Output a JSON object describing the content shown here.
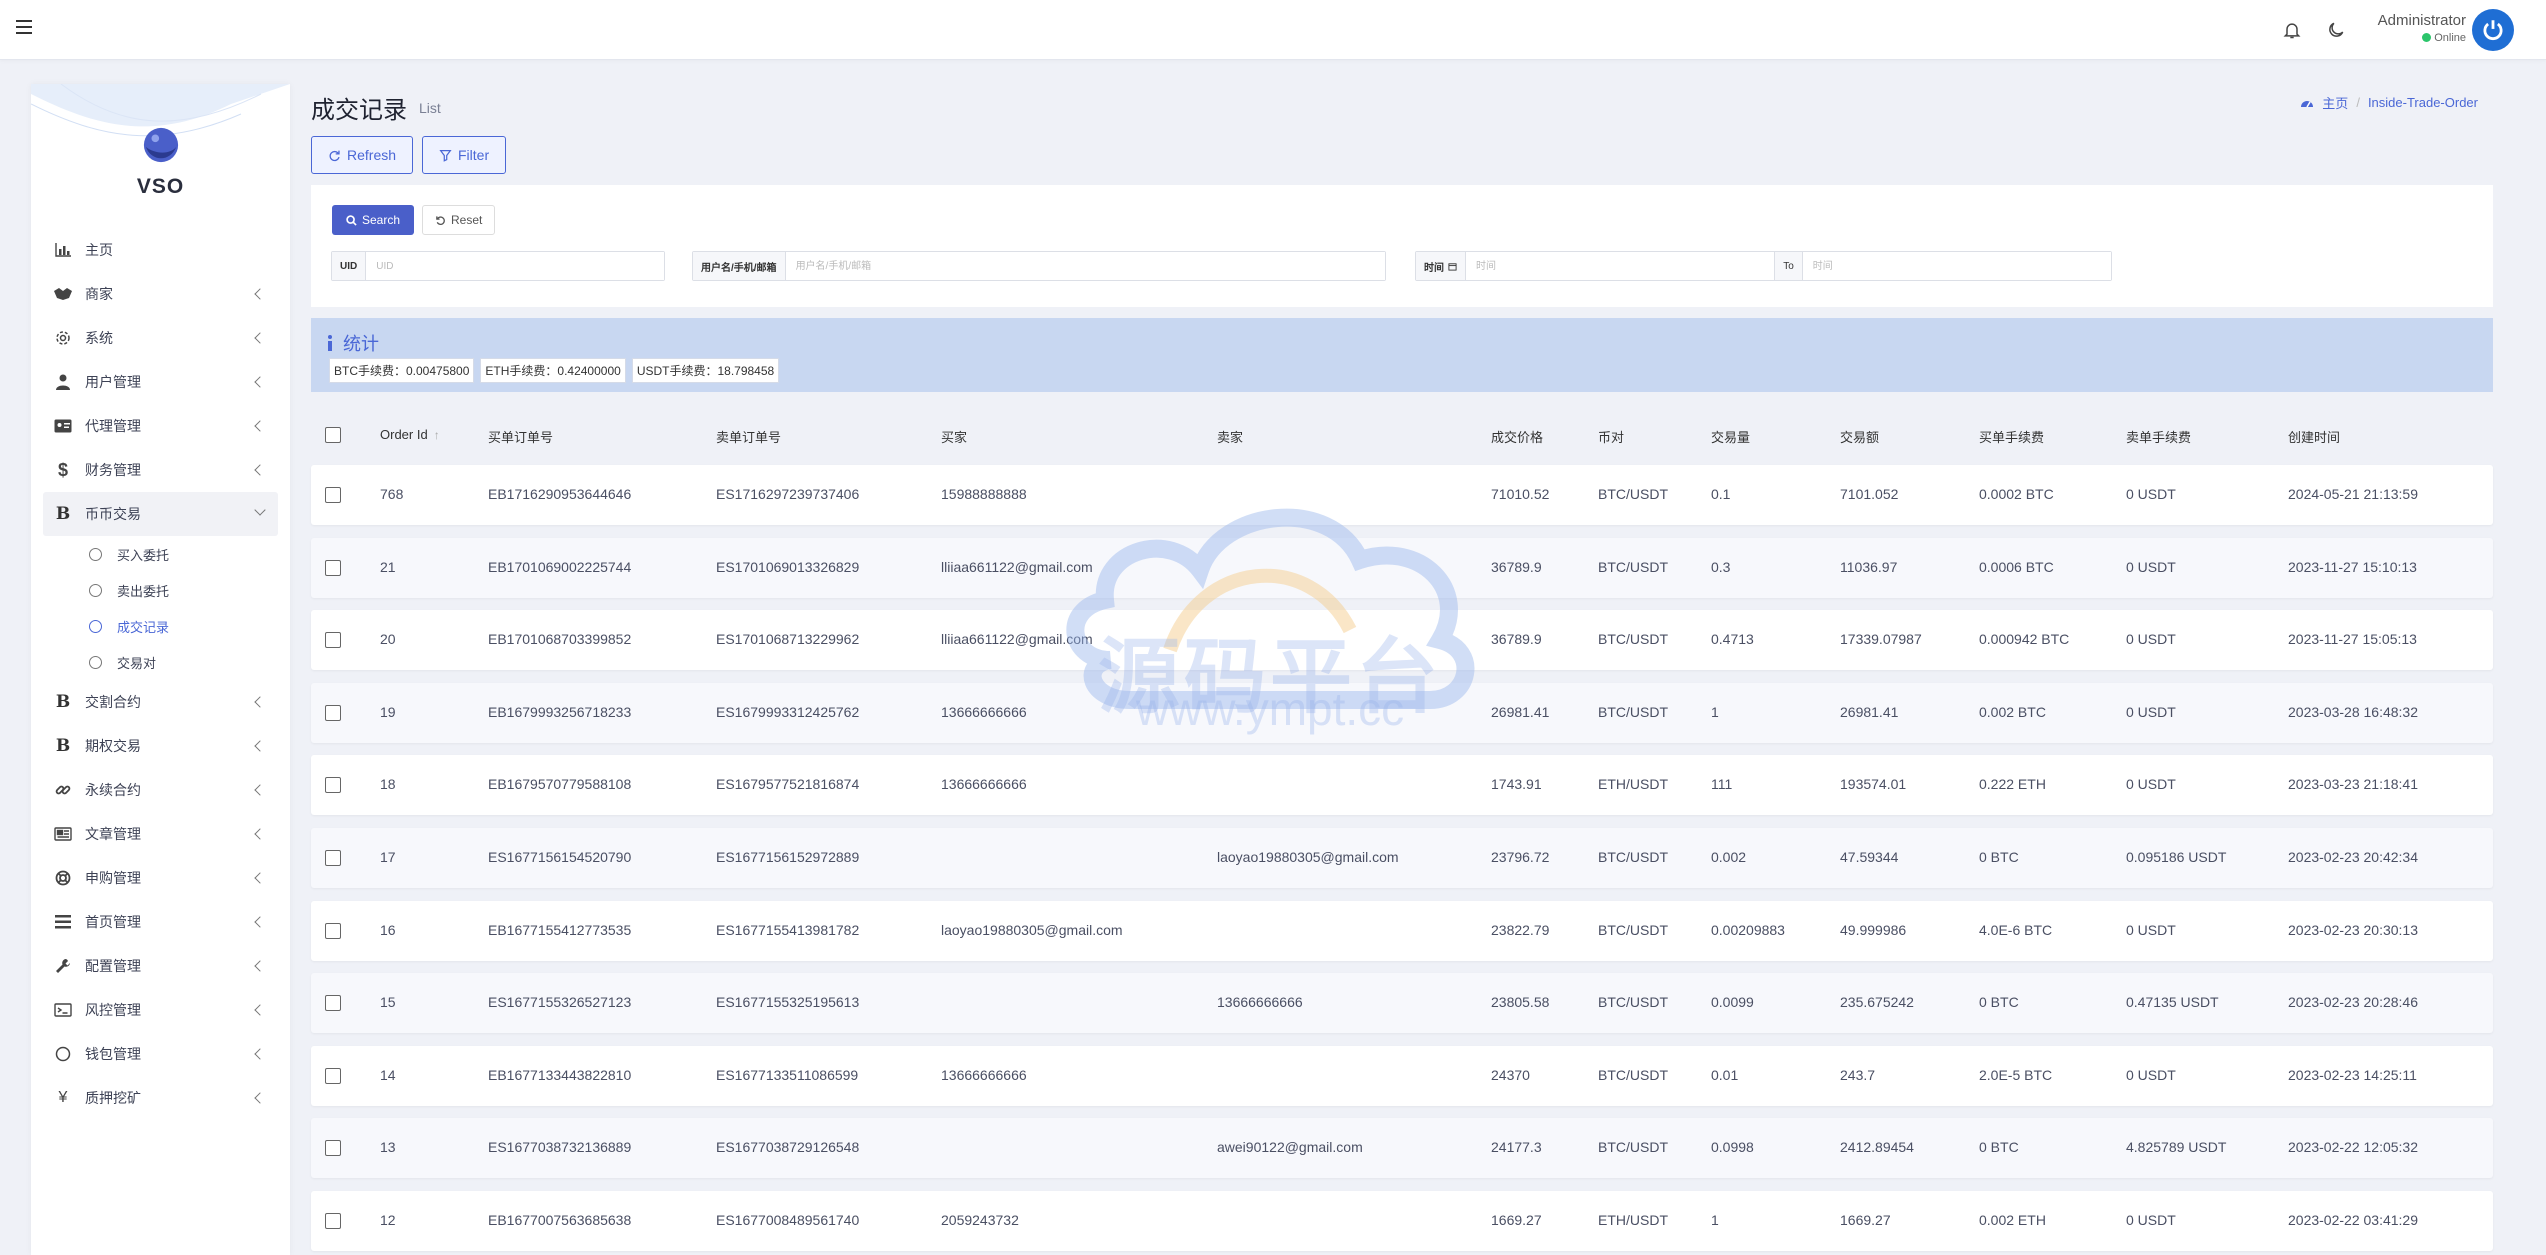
{
  "topbar": {
    "user_name": "Administrator",
    "user_status": "Online"
  },
  "brand": {
    "name": "VSO"
  },
  "sidebar": {
    "items": [
      {
        "label": "主页",
        "icon": "bar-chart-icon",
        "has_children": false
      },
      {
        "label": "商家",
        "icon": "handshake-icon",
        "has_children": true
      },
      {
        "label": "系统",
        "icon": "gear-icon",
        "has_children": true
      },
      {
        "label": "用户管理",
        "icon": "user-icon",
        "has_children": true
      },
      {
        "label": "代理管理",
        "icon": "id-card-icon",
        "has_children": true
      },
      {
        "label": "财务管理",
        "icon": "dollar-icon",
        "has_children": true
      },
      {
        "label": "币币交易",
        "icon": "bitcoin-icon",
        "has_children": true,
        "open": true
      },
      {
        "label": "交割合约",
        "icon": "bitcoin-icon",
        "has_children": true
      },
      {
        "label": "期权交易",
        "icon": "bitcoin-icon",
        "has_children": true
      },
      {
        "label": "永续合约",
        "icon": "link-icon",
        "has_children": true
      },
      {
        "label": "文章管理",
        "icon": "newspaper-icon",
        "has_children": true
      },
      {
        "label": "申购管理",
        "icon": "lifebuoy-icon",
        "has_children": true
      },
      {
        "label": "首页管理",
        "icon": "list-icon",
        "has_children": true
      },
      {
        "label": "配置管理",
        "icon": "wrench-icon",
        "has_children": true
      },
      {
        "label": "风控管理",
        "icon": "terminal-icon",
        "has_children": true
      },
      {
        "label": "钱包管理",
        "icon": "circle-icon",
        "has_children": true
      },
      {
        "label": "质押挖矿",
        "icon": "yen-icon",
        "has_children": true
      }
    ],
    "subitems": [
      {
        "label": "买入委托",
        "active": false
      },
      {
        "label": "卖出委托",
        "active": false
      },
      {
        "label": "成交记录",
        "active": true
      },
      {
        "label": "交易对",
        "active": false
      }
    ]
  },
  "page": {
    "title": "成交记录",
    "subtitle": "List",
    "breadcrumb_home": "主页",
    "breadcrumb_current": "Inside-Trade-Order"
  },
  "toolbar": {
    "refresh_label": "Refresh",
    "filter_label": "Filter"
  },
  "filter": {
    "search_label": "Search",
    "reset_label": "Reset",
    "uid_label": "UID",
    "uid_placeholder": "UID",
    "user_label": "用户名/手机/邮箱",
    "user_placeholder": "用户名/手机/邮箱",
    "time_label": "时间",
    "time_from_placeholder": "时间",
    "to_label": "To",
    "time_to_placeholder": "时间"
  },
  "stats": {
    "title": "统计",
    "tags": [
      "BTC手续费：0.00475800",
      "ETH手续费：0.42400000",
      "USDT手续费：18.798458"
    ]
  },
  "table": {
    "columns": [
      "Order Id",
      "买单订单号",
      "卖单订单号",
      "买家",
      "卖家",
      "成交价格",
      "币对",
      "交易量",
      "交易额",
      "买单手续费",
      "卖单手续费",
      "创建时间"
    ],
    "rows": [
      [
        "768",
        "EB1716290953644646",
        "ES1716297239737406",
        "15988888888",
        "",
        "71010.52",
        "BTC/USDT",
        "0.1",
        "7101.052",
        "0.0002 BTC",
        "0 USDT",
        "2024-05-21 21:13:59"
      ],
      [
        "21",
        "EB1701069002225744",
        "ES1701069013326829",
        "lliiaa661122@gmail.com",
        "",
        "36789.9",
        "BTC/USDT",
        "0.3",
        "11036.97",
        "0.0006 BTC",
        "0 USDT",
        "2023-11-27 15:10:13"
      ],
      [
        "20",
        "EB1701068703399852",
        "ES1701068713229962",
        "lliiaa661122@gmail.com",
        "",
        "36789.9",
        "BTC/USDT",
        "0.4713",
        "17339.07987",
        "0.000942 BTC",
        "0 USDT",
        "2023-11-27 15:05:13"
      ],
      [
        "19",
        "EB1679993256718233",
        "ES1679993312425762",
        "13666666666",
        "",
        "26981.41",
        "BTC/USDT",
        "1",
        "26981.41",
        "0.002 BTC",
        "0 USDT",
        "2023-03-28 16:48:32"
      ],
      [
        "18",
        "EB1679570779588108",
        "ES1679577521816874",
        "13666666666",
        "",
        "1743.91",
        "ETH/USDT",
        "111",
        "193574.01",
        "0.222 ETH",
        "0 USDT",
        "2023-03-23 21:18:41"
      ],
      [
        "17",
        "ES1677156154520790",
        "ES1677156152972889",
        "",
        "laoyao19880305@gmail.com",
        "23796.72",
        "BTC/USDT",
        "0.002",
        "47.59344",
        "0 BTC",
        "0.095186 USDT",
        "2023-02-23 20:42:34"
      ],
      [
        "16",
        "EB1677155412773535",
        "ES1677155413981782",
        "laoyao19880305@gmail.com",
        "",
        "23822.79",
        "BTC/USDT",
        "0.00209883",
        "49.999986",
        "4.0E-6 BTC",
        "0 USDT",
        "2023-02-23 20:30:13"
      ],
      [
        "15",
        "ES1677155326527123",
        "ES1677155325195613",
        "",
        "13666666666",
        "23805.58",
        "BTC/USDT",
        "0.0099",
        "235.675242",
        "0 BTC",
        "0.47135 USDT",
        "2023-02-23 20:28:46"
      ],
      [
        "14",
        "EB1677133443822810",
        "ES1677133511086599",
        "13666666666",
        "",
        "24370",
        "BTC/USDT",
        "0.01",
        "243.7",
        "2.0E-5 BTC",
        "0 USDT",
        "2023-02-23 14:25:11"
      ],
      [
        "13",
        "ES1677038732136889",
        "ES1677038729126548",
        "",
        "awei90122@gmail.com",
        "24177.3",
        "BTC/USDT",
        "0.0998",
        "2412.89454",
        "0 BTC",
        "4.825789 USDT",
        "2023-02-22 12:05:32"
      ],
      [
        "12",
        "EB1677007563685638",
        "ES1677008489561740",
        "2059243732",
        "",
        "1669.27",
        "ETH/USDT",
        "1",
        "1669.27",
        "0.002 ETH",
        "0 USDT",
        "2023-02-22 03:41:29"
      ]
    ]
  },
  "watermark": {
    "text": "源码平台",
    "url": "www.ympt.cc"
  },
  "colors": {
    "accent": "#4a67d6",
    "online": "#2bc56b",
    "stats_bg": "#c8d7f1"
  }
}
